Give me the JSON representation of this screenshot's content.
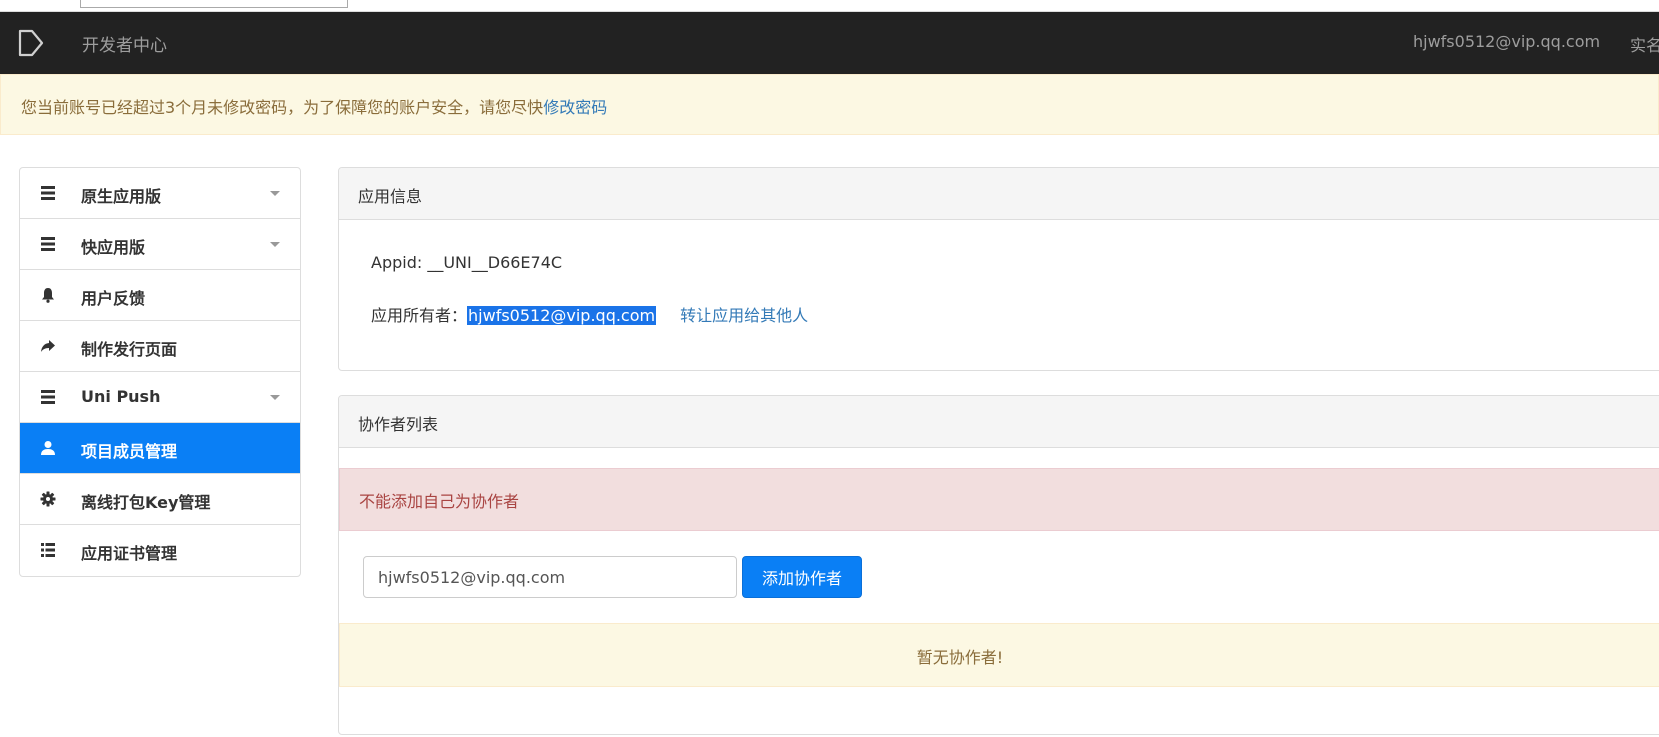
{
  "navbar": {
    "brand": "开发者中心",
    "user_email": "hjwfs0512@vip.qq.com",
    "realname_link": "实名"
  },
  "alert": {
    "message": "您当前账号已经超过3个月未修改密码，为了保障您的账户安全，请您尽快",
    "link": "修改密码"
  },
  "sidebar": {
    "items": [
      {
        "label": "原生应用版",
        "icon": "list-icon",
        "expandable": true
      },
      {
        "label": "快应用版",
        "icon": "list-icon",
        "expandable": true
      },
      {
        "label": "用户反馈",
        "icon": "bell-icon",
        "expandable": false
      },
      {
        "label": "制作发行页面",
        "icon": "share-arrow-icon",
        "expandable": false
      },
      {
        "label": "Uni Push",
        "icon": "list-icon",
        "expandable": true
      },
      {
        "label": "项目成员管理",
        "icon": "user-icon",
        "expandable": false,
        "active": true
      },
      {
        "label": "离线打包Key管理",
        "icon": "gear-icon",
        "expandable": false
      },
      {
        "label": "应用证书管理",
        "icon": "list-detail-icon",
        "expandable": false
      }
    ]
  },
  "app_info": {
    "title": "应用信息",
    "appid_label": "Appid: ",
    "appid_value": "__UNI__D66E74C",
    "owner_label": "应用所有者：",
    "owner_email": "hjwfs0512@vip.qq.com",
    "transfer_link": "转让应用给其他人"
  },
  "collaborators": {
    "title": "协作者列表",
    "error": "不能添加自己为协作者",
    "input_value": "hjwfs0512@vip.qq.com",
    "add_button": "添加协作者",
    "empty_message": "暂无协作者!"
  },
  "colors": {
    "navbar_bg": "#222222",
    "primary": "#0a7ff5",
    "warning_bg": "#fcf8e3",
    "danger_bg": "#f2dede"
  }
}
